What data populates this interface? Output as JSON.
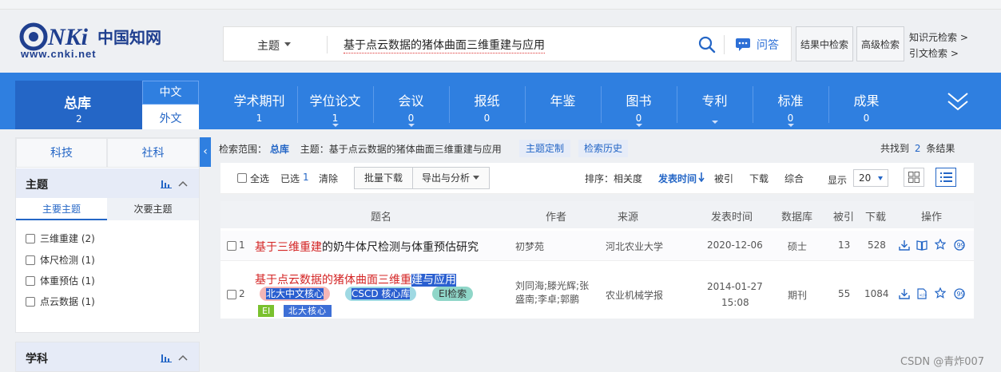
{
  "brand": {
    "logo_text": "CNKi中国知网",
    "logo_url": "www.cnki.net"
  },
  "search": {
    "scope": "主题",
    "query": "基于点云数据的猪体曲面三维重建与应用",
    "ask_label": "问答",
    "in_results_label": "结果中检索",
    "advanced_label": "高级检索",
    "knowledge_label": "知识元检索 >",
    "citation_label": "引文检索 >"
  },
  "nav": {
    "total": {
      "label": "总库",
      "count": "2"
    },
    "lang": {
      "chinese": "中文",
      "foreign": "外文"
    },
    "items": [
      {
        "label": "学术期刊",
        "count": "1"
      },
      {
        "label": "学位论文",
        "count": "1"
      },
      {
        "label": "会议",
        "count": "0"
      },
      {
        "label": "报纸",
        "count": "0"
      },
      {
        "label": "年鉴",
        "count": ""
      },
      {
        "label": "图书",
        "count": "0"
      },
      {
        "label": "专利",
        "count": ""
      },
      {
        "label": "标准",
        "count": "0"
      },
      {
        "label": "成果",
        "count": "0"
      }
    ]
  },
  "sidebar": {
    "tabs": [
      "科技",
      "社科"
    ],
    "section_title": "主题",
    "subtabs": [
      "主要主题",
      "次要主题"
    ],
    "items": [
      {
        "label": "三维重建",
        "count": "(2)"
      },
      {
        "label": "体尺检测",
        "count": "(1)"
      },
      {
        "label": "体重预估",
        "count": "(1)"
      },
      {
        "label": "点云数据",
        "count": "(1)"
      }
    ],
    "section2_title": "学科"
  },
  "crumb": {
    "scope_label": "检索范围：",
    "scope_value": "总库",
    "topic": "主题：基于点云数据的猪体曲面三维重建与应用",
    "customize": "主题定制",
    "history": "检索历史",
    "found_prefix": "共找到",
    "found_count": "2",
    "found_suffix": "条结果"
  },
  "toolbar": {
    "select_all": "全选",
    "selected_label": "已选",
    "selected_count": "1",
    "clear": "清除",
    "batch_download": "批量下载",
    "export": "导出与分析",
    "sort_label": "排序：",
    "sort_relevance": "相关度",
    "sort_date": "发表时间",
    "sort_cited": "被引",
    "sort_download": "下载",
    "sort_overall": "综合",
    "show_label": "显示",
    "page_size": "20"
  },
  "table": {
    "headers": [
      "题名",
      "作者",
      "来源",
      "发表时间",
      "数据库",
      "被引",
      "下载",
      "操作"
    ],
    "rows": [
      {
        "num": "1",
        "title_red": "基于三维重建",
        "title_rest": "的奶牛体尺检测与体重预估研究",
        "author": "初梦苑",
        "source": "河北农业大学",
        "date": "2020-12-06",
        "db": "硕士",
        "cited": "13",
        "downloads": "528"
      },
      {
        "num": "2",
        "title_red": "基于点云数据的猪体曲面三维重",
        "title_rest": "建与应用",
        "author": "刘同海;滕光辉;张盛南;李卓;郭鹏",
        "source": "农业机械学报",
        "date": "2014-01-27",
        "time": "15:08",
        "db": "期刊",
        "cited": "55",
        "downloads": "1084",
        "tags": [
          "北大中文核心",
          "CSCD 核心库",
          "EI检索"
        ],
        "badges": [
          "EI",
          "北大核心"
        ]
      }
    ]
  },
  "watermark": "CSDN @青炸007",
  "colors": {
    "primary": "#2f7fe0",
    "dark_blue": "#2466c6",
    "highlight_red": "#d42424"
  }
}
